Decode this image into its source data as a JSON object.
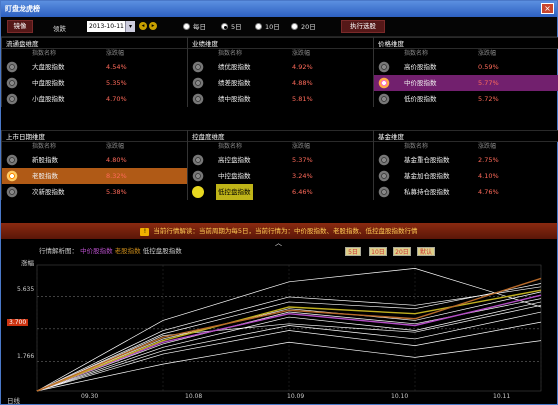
{
  "window": {
    "title": "盯盘龙虎榜",
    "close": "×"
  },
  "toolbar": {
    "prev_label": "镜像",
    "cycle_label": "领跌",
    "date_value": "2013-10-11",
    "radios": [
      {
        "label": "每日",
        "selected": false
      },
      {
        "label": "5日",
        "selected": true
      },
      {
        "label": "10日",
        "selected": false
      },
      {
        "label": "20日",
        "selected": false
      }
    ],
    "exec_label": "执行选股"
  },
  "columns": {
    "name": "指数名称",
    "change": "涨跌幅"
  },
  "panels": [
    {
      "title": "流通盘维度",
      "rows": [
        {
          "name": "大盘股指数",
          "pct": "4.54%",
          "icon": "gear-icon",
          "highlight": ""
        },
        {
          "name": "中盘股指数",
          "pct": "5.35%",
          "icon": "gear-icon",
          "highlight": ""
        },
        {
          "name": "小盘股指数",
          "pct": "4.70%",
          "icon": "gear-icon",
          "highlight": ""
        }
      ]
    },
    {
      "title": "业绩维度",
      "rows": [
        {
          "name": "绩优股指数",
          "pct": "4.92%",
          "icon": "gear-icon",
          "highlight": ""
        },
        {
          "name": "绩差股指数",
          "pct": "4.88%",
          "icon": "gear-icon",
          "highlight": ""
        },
        {
          "name": "绩中股指数",
          "pct": "5.81%",
          "icon": "gear-icon",
          "highlight": ""
        }
      ]
    },
    {
      "title": "价格维度",
      "rows": [
        {
          "name": "高价股指数",
          "pct": "0.59%",
          "icon": "gear-icon",
          "highlight": ""
        },
        {
          "name": "中价股指数",
          "pct": "5.77%",
          "icon": "flower-icon",
          "highlight": "purple"
        },
        {
          "name": "低价股指数",
          "pct": "5.72%",
          "icon": "gear-icon",
          "highlight": ""
        }
      ]
    },
    {
      "title": "上市日期维度",
      "rows": [
        {
          "name": "新股指数",
          "pct": "4.80%",
          "icon": "gear-icon",
          "highlight": ""
        },
        {
          "name": "老股指数",
          "pct": "8.32%",
          "icon": "sun-icon",
          "highlight": "orange"
        },
        {
          "name": "次新股指数",
          "pct": "5.38%",
          "icon": "gear-icon",
          "highlight": ""
        }
      ]
    },
    {
      "title": "控盘度维度",
      "rows": [
        {
          "name": "高控盘指数",
          "pct": "5.37%",
          "icon": "gear-icon",
          "highlight": ""
        },
        {
          "name": "中控盘指数",
          "pct": "3.24%",
          "icon": "gear-icon",
          "highlight": ""
        },
        {
          "name": "低控盘指数",
          "pct": "6.46%",
          "icon": "sun-icon",
          "highlight": "yellow"
        }
      ]
    },
    {
      "title": "基金维度",
      "rows": [
        {
          "name": "基金重仓股指数",
          "pct": "2.75%",
          "icon": "gear-icon",
          "highlight": ""
        },
        {
          "name": "基金加仓股指数",
          "pct": "4.10%",
          "icon": "gear-icon",
          "highlight": ""
        },
        {
          "name": "私募持仓股指数",
          "pct": "4.76%",
          "icon": "gear-icon",
          "highlight": ""
        }
      ]
    }
  ],
  "infobar": {
    "text": "当前行情解读：当前周期为每5日，当前行情为：中价股指数、老股指数、低控盘股指数行情"
  },
  "chart_header": {
    "prefix": "行情解析图：",
    "s1": "中价股指数",
    "s2": "老股指数",
    "s3": "低控盘股指数"
  },
  "period_buttons": [
    "5日",
    "10日",
    "20日",
    "默认"
  ],
  "chart_data": {
    "type": "line",
    "ylabel": "涨幅",
    "yticks": [
      "5.635",
      "3.700",
      "1.766"
    ],
    "x": [
      "09.30",
      "10.08",
      "10.09",
      "10.10",
      "10.11"
    ],
    "xlabel_left": "日线",
    "ylim": [
      0,
      7.5
    ],
    "series": [
      {
        "color": "#b86a2a",
        "values": [
          0,
          3.2,
          4.8,
          4.3,
          6.7
        ]
      },
      {
        "color": "#c0b020",
        "values": [
          0,
          3.0,
          5.0,
          4.6,
          6.0
        ]
      },
      {
        "color": "#b54ec7",
        "values": [
          0,
          2.9,
          4.6,
          3.9,
          5.7
        ]
      },
      {
        "color": "#ffffff",
        "values": [
          0,
          3.4,
          5.3,
          4.9,
          6.4
        ]
      },
      {
        "color": "#ffffff",
        "values": [
          0,
          2.6,
          4.4,
          3.6,
          5.3
        ]
      },
      {
        "color": "#ffffff",
        "values": [
          0,
          3.1,
          4.9,
          4.2,
          5.9
        ]
      },
      {
        "color": "#ffffff",
        "values": [
          0,
          2.4,
          3.9,
          3.1,
          4.7
        ]
      },
      {
        "color": "#ffffff",
        "values": [
          0,
          3.6,
          5.6,
          5.1,
          6.2
        ]
      },
      {
        "color": "#ffffff",
        "values": [
          0,
          2.2,
          3.6,
          2.7,
          4.1
        ]
      },
      {
        "color": "#ffffff",
        "values": [
          0,
          2.8,
          4.7,
          4.0,
          5.5
        ]
      },
      {
        "color": "#ffffff",
        "values": [
          0,
          1.6,
          2.9,
          2.0,
          3.0
        ]
      },
      {
        "color": "#ffffff",
        "values": [
          0,
          4.2,
          6.5,
          7.3,
          5.0
        ]
      },
      {
        "color": "#ffffff",
        "values": [
          0,
          3.3,
          4.0,
          3.5,
          5.1
        ]
      }
    ]
  }
}
